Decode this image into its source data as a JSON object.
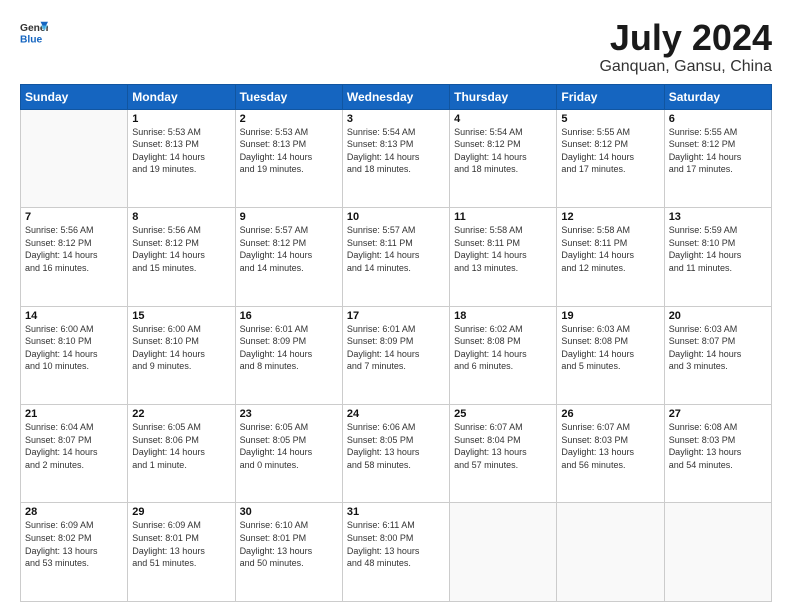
{
  "header": {
    "logo_line1": "General",
    "logo_line2": "Blue",
    "title": "July 2024",
    "subtitle": "Ganquan, Gansu, China"
  },
  "days": [
    "Sunday",
    "Monday",
    "Tuesday",
    "Wednesday",
    "Thursday",
    "Friday",
    "Saturday"
  ],
  "weeks": [
    [
      {
        "num": "",
        "text": ""
      },
      {
        "num": "1",
        "text": "Sunrise: 5:53 AM\nSunset: 8:13 PM\nDaylight: 14 hours\nand 19 minutes."
      },
      {
        "num": "2",
        "text": "Sunrise: 5:53 AM\nSunset: 8:13 PM\nDaylight: 14 hours\nand 19 minutes."
      },
      {
        "num": "3",
        "text": "Sunrise: 5:54 AM\nSunset: 8:13 PM\nDaylight: 14 hours\nand 18 minutes."
      },
      {
        "num": "4",
        "text": "Sunrise: 5:54 AM\nSunset: 8:12 PM\nDaylight: 14 hours\nand 18 minutes."
      },
      {
        "num": "5",
        "text": "Sunrise: 5:55 AM\nSunset: 8:12 PM\nDaylight: 14 hours\nand 17 minutes."
      },
      {
        "num": "6",
        "text": "Sunrise: 5:55 AM\nSunset: 8:12 PM\nDaylight: 14 hours\nand 17 minutes."
      }
    ],
    [
      {
        "num": "7",
        "text": "Sunrise: 5:56 AM\nSunset: 8:12 PM\nDaylight: 14 hours\nand 16 minutes."
      },
      {
        "num": "8",
        "text": "Sunrise: 5:56 AM\nSunset: 8:12 PM\nDaylight: 14 hours\nand 15 minutes."
      },
      {
        "num": "9",
        "text": "Sunrise: 5:57 AM\nSunset: 8:12 PM\nDaylight: 14 hours\nand 14 minutes."
      },
      {
        "num": "10",
        "text": "Sunrise: 5:57 AM\nSunset: 8:11 PM\nDaylight: 14 hours\nand 14 minutes."
      },
      {
        "num": "11",
        "text": "Sunrise: 5:58 AM\nSunset: 8:11 PM\nDaylight: 14 hours\nand 13 minutes."
      },
      {
        "num": "12",
        "text": "Sunrise: 5:58 AM\nSunset: 8:11 PM\nDaylight: 14 hours\nand 12 minutes."
      },
      {
        "num": "13",
        "text": "Sunrise: 5:59 AM\nSunset: 8:10 PM\nDaylight: 14 hours\nand 11 minutes."
      }
    ],
    [
      {
        "num": "14",
        "text": "Sunrise: 6:00 AM\nSunset: 8:10 PM\nDaylight: 14 hours\nand 10 minutes."
      },
      {
        "num": "15",
        "text": "Sunrise: 6:00 AM\nSunset: 8:10 PM\nDaylight: 14 hours\nand 9 minutes."
      },
      {
        "num": "16",
        "text": "Sunrise: 6:01 AM\nSunset: 8:09 PM\nDaylight: 14 hours\nand 8 minutes."
      },
      {
        "num": "17",
        "text": "Sunrise: 6:01 AM\nSunset: 8:09 PM\nDaylight: 14 hours\nand 7 minutes."
      },
      {
        "num": "18",
        "text": "Sunrise: 6:02 AM\nSunset: 8:08 PM\nDaylight: 14 hours\nand 6 minutes."
      },
      {
        "num": "19",
        "text": "Sunrise: 6:03 AM\nSunset: 8:08 PM\nDaylight: 14 hours\nand 5 minutes."
      },
      {
        "num": "20",
        "text": "Sunrise: 6:03 AM\nSunset: 8:07 PM\nDaylight: 14 hours\nand 3 minutes."
      }
    ],
    [
      {
        "num": "21",
        "text": "Sunrise: 6:04 AM\nSunset: 8:07 PM\nDaylight: 14 hours\nand 2 minutes."
      },
      {
        "num": "22",
        "text": "Sunrise: 6:05 AM\nSunset: 8:06 PM\nDaylight: 14 hours\nand 1 minute."
      },
      {
        "num": "23",
        "text": "Sunrise: 6:05 AM\nSunset: 8:05 PM\nDaylight: 14 hours\nand 0 minutes."
      },
      {
        "num": "24",
        "text": "Sunrise: 6:06 AM\nSunset: 8:05 PM\nDaylight: 13 hours\nand 58 minutes."
      },
      {
        "num": "25",
        "text": "Sunrise: 6:07 AM\nSunset: 8:04 PM\nDaylight: 13 hours\nand 57 minutes."
      },
      {
        "num": "26",
        "text": "Sunrise: 6:07 AM\nSunset: 8:03 PM\nDaylight: 13 hours\nand 56 minutes."
      },
      {
        "num": "27",
        "text": "Sunrise: 6:08 AM\nSunset: 8:03 PM\nDaylight: 13 hours\nand 54 minutes."
      }
    ],
    [
      {
        "num": "28",
        "text": "Sunrise: 6:09 AM\nSunset: 8:02 PM\nDaylight: 13 hours\nand 53 minutes."
      },
      {
        "num": "29",
        "text": "Sunrise: 6:09 AM\nSunset: 8:01 PM\nDaylight: 13 hours\nand 51 minutes."
      },
      {
        "num": "30",
        "text": "Sunrise: 6:10 AM\nSunset: 8:01 PM\nDaylight: 13 hours\nand 50 minutes."
      },
      {
        "num": "31",
        "text": "Sunrise: 6:11 AM\nSunset: 8:00 PM\nDaylight: 13 hours\nand 48 minutes."
      },
      {
        "num": "",
        "text": ""
      },
      {
        "num": "",
        "text": ""
      },
      {
        "num": "",
        "text": ""
      }
    ]
  ]
}
